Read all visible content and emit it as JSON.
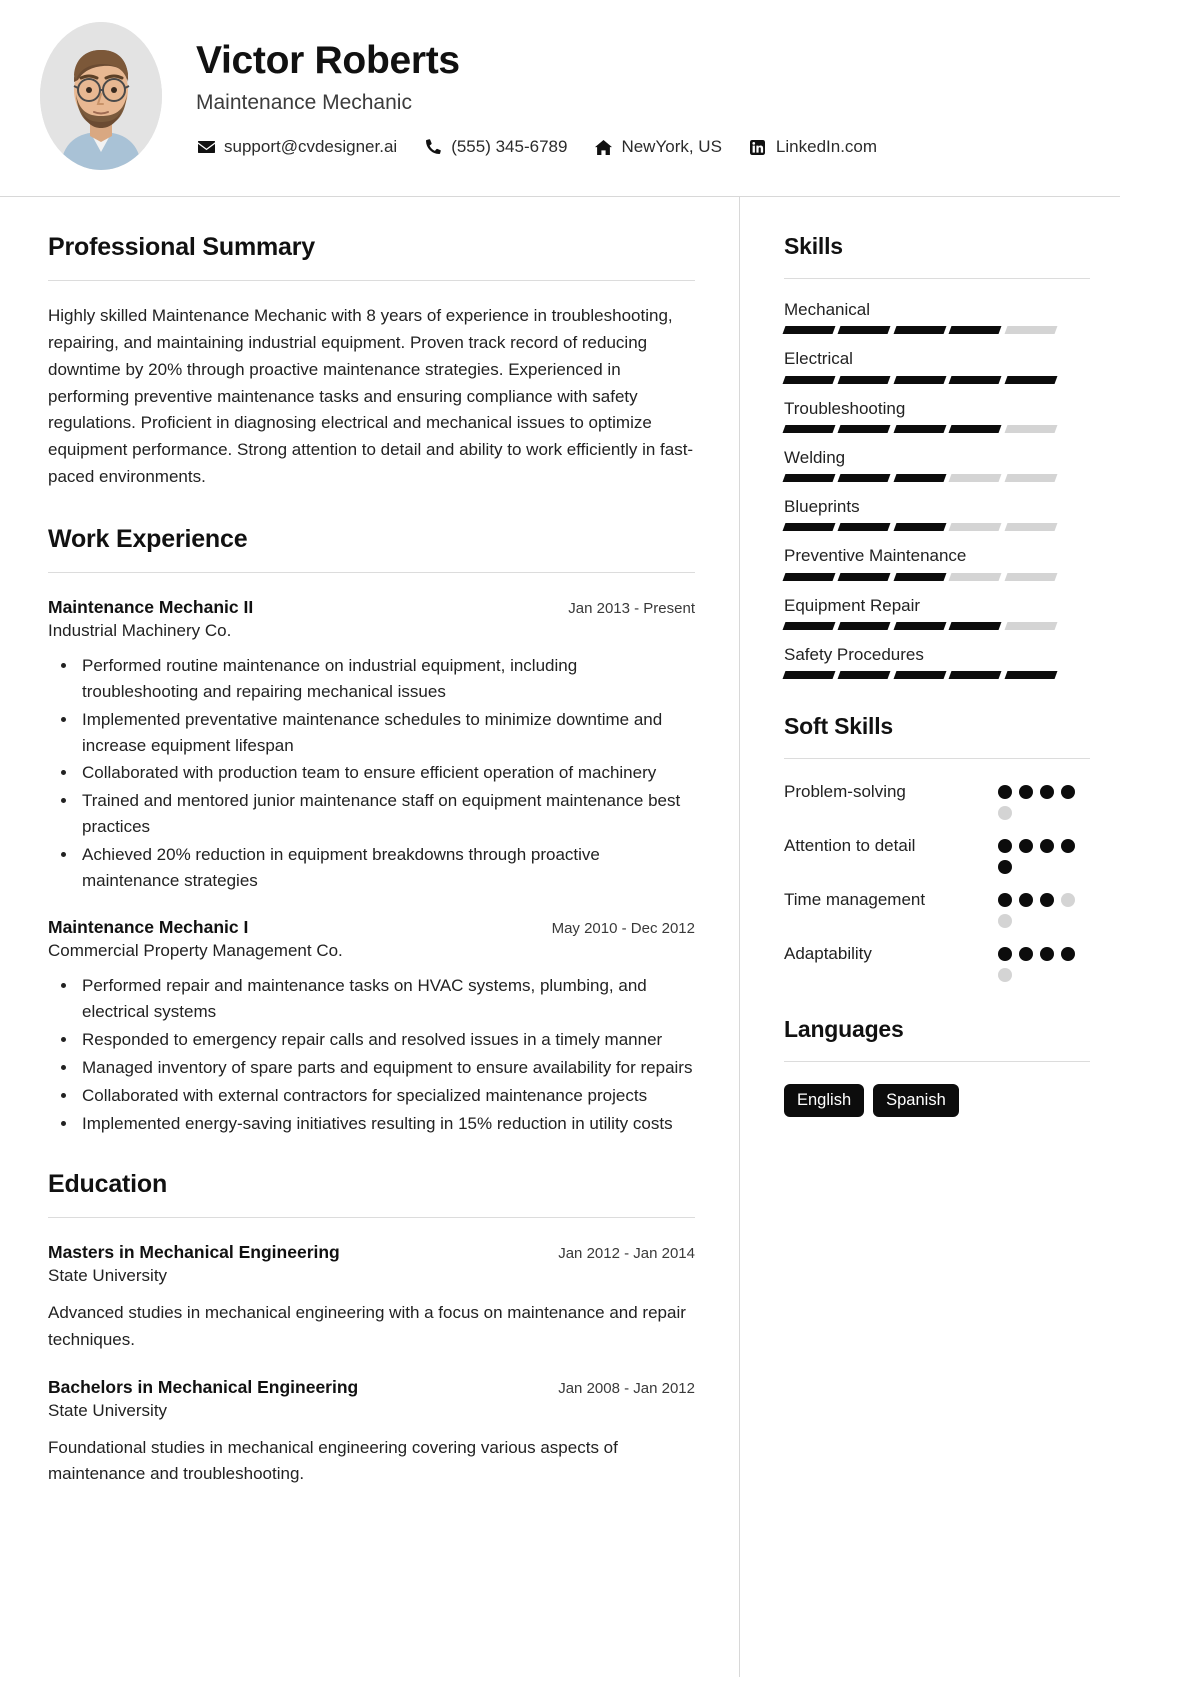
{
  "header": {
    "name": "Victor Roberts",
    "title": "Maintenance Mechanic",
    "avatar_alt": "profile-photo",
    "contacts": [
      {
        "icon": "envelope-icon",
        "value": "support@cvdesigner.ai"
      },
      {
        "icon": "phone-icon",
        "value": "(555) 345-6789"
      },
      {
        "icon": "home-icon",
        "value": "NewYork, US"
      },
      {
        "icon": "linkedin-icon",
        "value": "LinkedIn.com"
      }
    ]
  },
  "summary": {
    "heading": "Professional Summary",
    "text": "Highly skilled Maintenance Mechanic with 8 years of experience in troubleshooting, repairing, and maintaining industrial equipment. Proven track record of reducing downtime by 20% through proactive maintenance strategies. Experienced in performing preventive maintenance tasks and ensuring compliance with safety regulations. Proficient in diagnosing electrical and mechanical issues to optimize equipment performance. Strong attention to detail and ability to work efficiently in fast-paced environments."
  },
  "experience": {
    "heading": "Work Experience",
    "items": [
      {
        "title": "Maintenance Mechanic II",
        "date": "Jan 2013 - Present",
        "org": "Industrial Machinery Co.",
        "bullets": [
          "Performed routine maintenance on industrial equipment, including troubleshooting and repairing mechanical issues",
          "Implemented preventative maintenance schedules to minimize downtime and increase equipment lifespan",
          "Collaborated with production team to ensure efficient operation of machinery",
          "Trained and mentored junior maintenance staff on equipment maintenance best practices",
          "Achieved 20% reduction in equipment breakdowns through proactive maintenance strategies"
        ]
      },
      {
        "title": "Maintenance Mechanic I",
        "date": "May 2010 - Dec 2012",
        "org": "Commercial Property Management Co.",
        "bullets": [
          "Performed repair and maintenance tasks on HVAC systems, plumbing, and electrical systems",
          "Responded to emergency repair calls and resolved issues in a timely manner",
          "Managed inventory of spare parts and equipment to ensure availability for repairs",
          "Collaborated with external contractors for specialized maintenance projects",
          "Implemented energy-saving initiatives resulting in 15% reduction in utility costs"
        ]
      }
    ]
  },
  "education": {
    "heading": "Education",
    "items": [
      {
        "title": "Masters in Mechanical Engineering",
        "date": "Jan 2012 - Jan 2014",
        "org": "State University",
        "desc": "Advanced studies in mechanical engineering with a focus on maintenance and repair techniques."
      },
      {
        "title": "Bachelors in Mechanical Engineering",
        "date": "Jan 2008 - Jan 2012",
        "org": "State University",
        "desc": "Foundational studies in mechanical engineering covering various aspects of maintenance and troubleshooting."
      }
    ]
  },
  "skills": {
    "heading": "Skills",
    "total_segments": 5,
    "items": [
      {
        "name": "Mechanical",
        "filled": 4
      },
      {
        "name": "Electrical",
        "filled": 5
      },
      {
        "name": "Troubleshooting",
        "filled": 4
      },
      {
        "name": "Welding",
        "filled": 3
      },
      {
        "name": "Blueprints",
        "filled": 3
      },
      {
        "name": "Preventive Maintenance",
        "filled": 3
      },
      {
        "name": "Equipment Repair",
        "filled": 4
      },
      {
        "name": "Safety Procedures",
        "filled": 5
      }
    ]
  },
  "soft_skills": {
    "heading": "Soft Skills",
    "total_dots": 5,
    "items": [
      {
        "name": "Problem-solving",
        "filled": 4
      },
      {
        "name": "Attention to detail",
        "filled": 5
      },
      {
        "name": "Time management",
        "filled": 3
      },
      {
        "name": "Adaptability",
        "filled": 4
      }
    ]
  },
  "languages": {
    "heading": "Languages",
    "items": [
      "English",
      "Spanish"
    ]
  },
  "colors": {
    "accent": "#0c0c0c",
    "muted_bar": "#d4d4d4",
    "rule": "#dcdcdc",
    "text": "#222222"
  }
}
